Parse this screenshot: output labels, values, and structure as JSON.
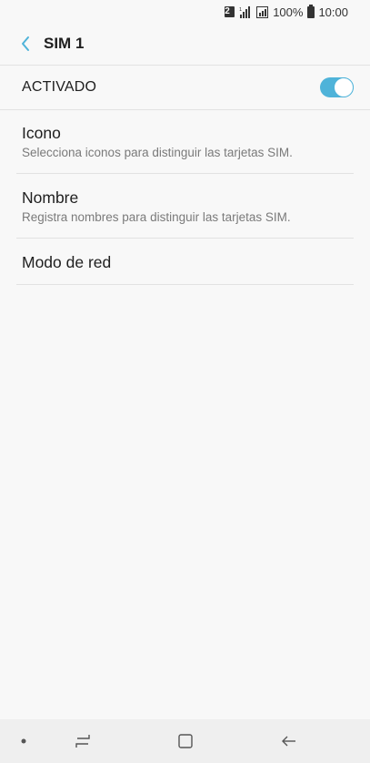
{
  "status_bar": {
    "sim_badge": "2",
    "battery_percent": "100%",
    "time": "10:00",
    "icons": [
      "sim2-icon",
      "signal-icon",
      "no-sim-icon",
      "battery-icon"
    ]
  },
  "app_bar": {
    "title": "SIM 1",
    "back_icon": "chevron-left-icon"
  },
  "master_switch": {
    "label": "ACTIVADO",
    "enabled": true,
    "accent_color": "#4fb3d9"
  },
  "settings": [
    {
      "title": "Icono",
      "subtitle": "Selecciona iconos para distinguir las tarjetas SIM."
    },
    {
      "title": "Nombre",
      "subtitle": "Registra nombres para distinguir las tarjetas SIM."
    },
    {
      "title": "Modo de red",
      "subtitle": ""
    }
  ],
  "nav_bar": {
    "buttons": [
      "dot-icon",
      "recent-apps-icon",
      "home-icon",
      "back-arrow-icon"
    ]
  }
}
